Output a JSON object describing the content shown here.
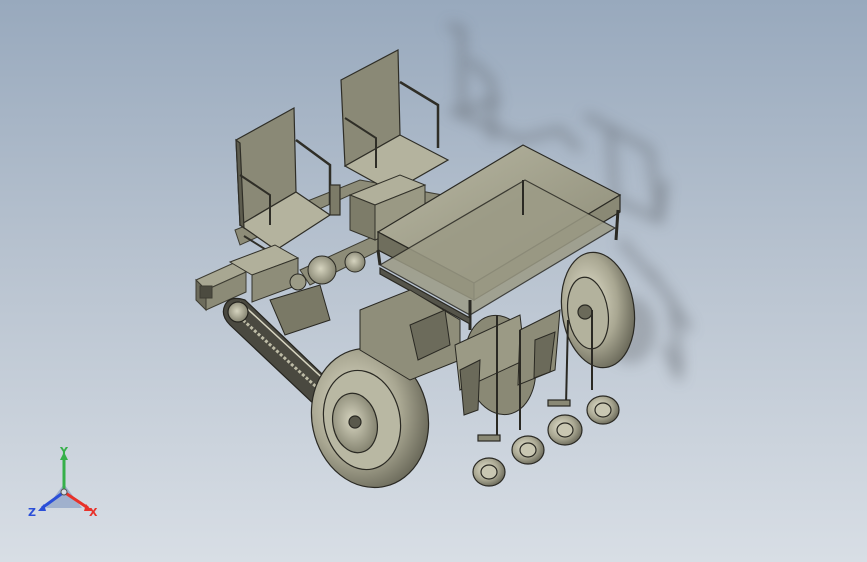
{
  "triad": {
    "x_label": "X",
    "y_label": "Y",
    "z_label": "Z",
    "x_color": "#e8322a",
    "y_color": "#36b04a",
    "z_color": "#2b4fd8"
  },
  "scene": {
    "background_top": "#98a9bd",
    "background_bottom": "#d8dee5",
    "model_fill": "#9d9c87",
    "model_light": "#cfcdb8",
    "model_dark": "#4b4a3f",
    "shadow_color": "#6f7479"
  }
}
